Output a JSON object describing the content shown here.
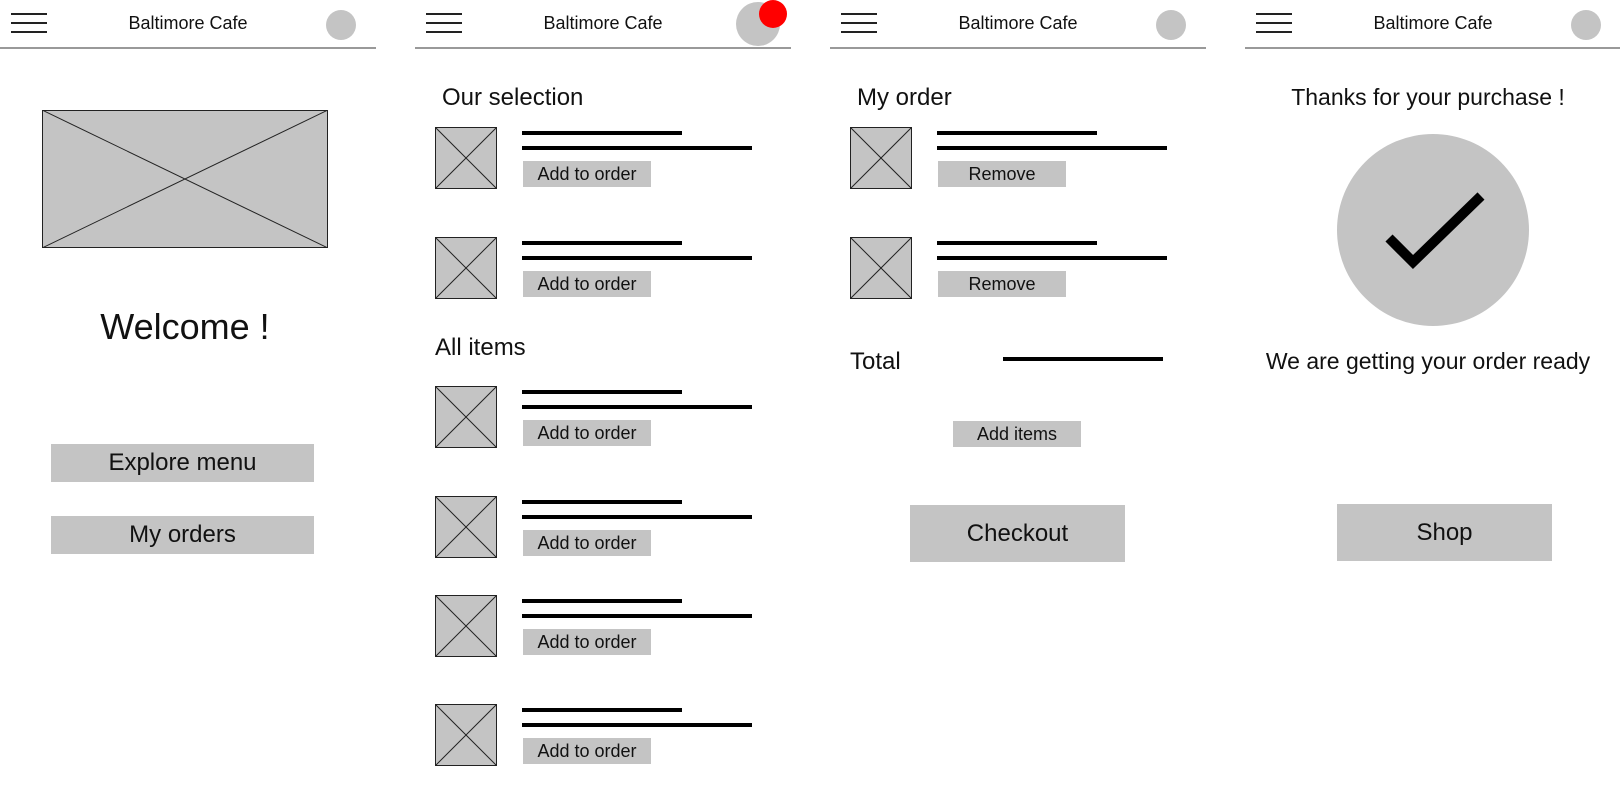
{
  "app_title": "Baltimore Cafe",
  "screen1": {
    "welcome": "Welcome !",
    "explore_button": "Explore menu",
    "orders_button": "My orders"
  },
  "screen2": {
    "section_selection": "Our selection",
    "section_all": "All items",
    "add_label": "Add to order"
  },
  "screen3": {
    "heading": "My order",
    "remove_label": "Remove",
    "total_label": "Total",
    "add_items_button": "Add items",
    "checkout_button": "Checkout"
  },
  "screen4": {
    "thanks": "Thanks for your purchase !",
    "status": "We are getting your order ready",
    "shop_button": "Shop"
  },
  "icons": {
    "menu": "hamburger-menu-icon",
    "profile": "profile-avatar-icon",
    "notification": "notification-dot-icon",
    "placeholder": "image-placeholder-icon",
    "check": "checkmark-icon"
  },
  "colors": {
    "placeholder_gray": "#c4c4c4",
    "notification_red": "#ff0000",
    "divider": "#999999"
  }
}
